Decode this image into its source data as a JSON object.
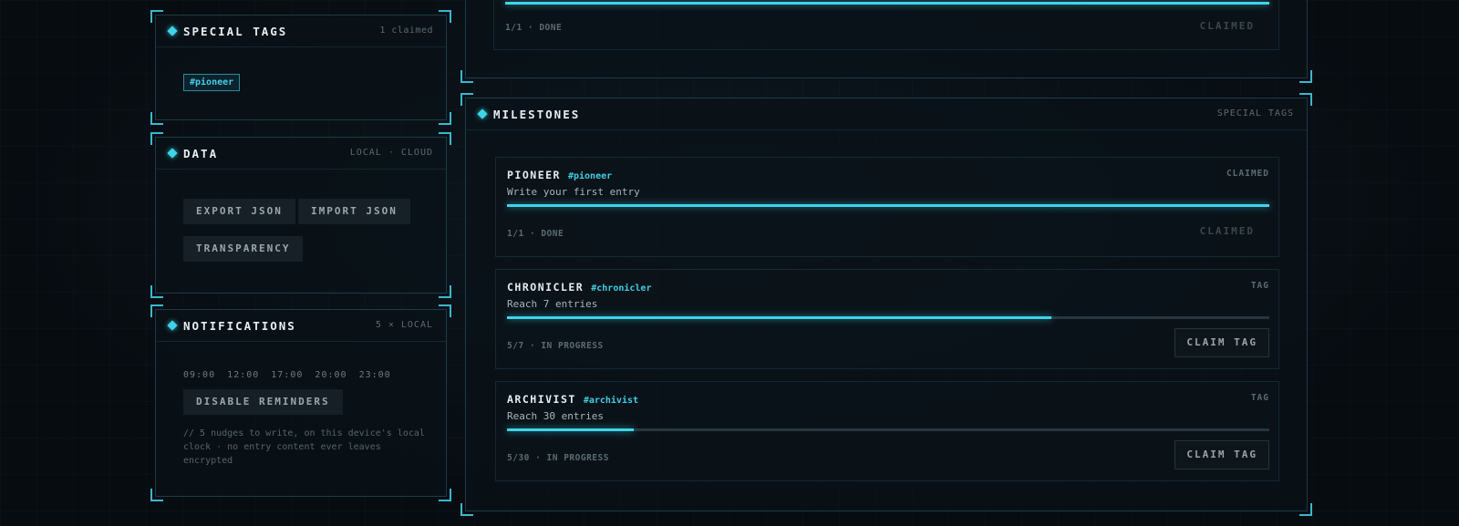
{
  "special_tags": {
    "title": "SPECIAL TAGS",
    "meta": "1 claimed",
    "tags": [
      "#pioneer"
    ]
  },
  "data_panel": {
    "title": "DATA",
    "meta": "LOCAL · CLOUD",
    "export_label": "EXPORT JSON",
    "import_label": "IMPORT JSON",
    "transparency_label": "TRANSPARENCY"
  },
  "notifications": {
    "title": "NOTIFICATIONS",
    "meta": "5 × LOCAL",
    "times": [
      "09:00",
      "12:00",
      "17:00",
      "20:00",
      "23:00"
    ],
    "disable_label": "DISABLE REMINDERS",
    "note": "// 5 nudges to write, on this device's local clock · no entry content ever leaves encrypted"
  },
  "top_card": {
    "status": "1/1 · DONE",
    "claimed_label": "CLAIMED",
    "progress": 1.0
  },
  "milestones": {
    "title": "MILESTONES",
    "meta": "SPECIAL TAGS",
    "items": [
      {
        "name": "PIONEER",
        "hash": "#pioneer",
        "kind": "CLAIMED",
        "desc": "Write your first entry",
        "current": 1,
        "target": 1,
        "status": "1/1 · DONE",
        "action": "CLAIMED",
        "claimed": true
      },
      {
        "name": "CHRONICLER",
        "hash": "#chronicler",
        "kind": "TAG",
        "desc": "Reach 7 entries",
        "current": 5,
        "target": 7,
        "status": "5/7 · IN PROGRESS",
        "action": "CLAIM TAG",
        "claimed": false
      },
      {
        "name": "ARCHIVIST",
        "hash": "#archivist",
        "kind": "TAG",
        "desc": "Reach 30 entries",
        "current": 5,
        "target": 30,
        "status": "5/30 · IN PROGRESS",
        "action": "CLAIM TAG",
        "claimed": false
      }
    ]
  },
  "colors": {
    "accent": "#3fd3ea",
    "panel_border": "#39b8cf",
    "background": "#070c11"
  }
}
